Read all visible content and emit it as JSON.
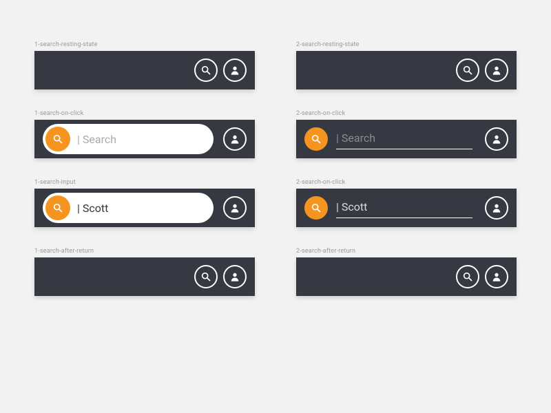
{
  "colors": {
    "bar_bg": "#363842",
    "accent": "#f5941e",
    "icon_stroke": "#ffffff",
    "page_bg": "#f2f2f2"
  },
  "search_placeholder": "| Search",
  "search_value": "| Scott",
  "left": {
    "resting": {
      "label": "1-search-resting-state"
    },
    "click": {
      "label": "1-search-on-click"
    },
    "input": {
      "label": "1-search-input"
    },
    "after": {
      "label": "1-search-after-return"
    }
  },
  "right": {
    "resting": {
      "label": "2-search-resting-state"
    },
    "click": {
      "label": "2-search-on-click"
    },
    "input": {
      "label": "2-search-on-click"
    },
    "after": {
      "label": "2-search-after-return"
    }
  }
}
